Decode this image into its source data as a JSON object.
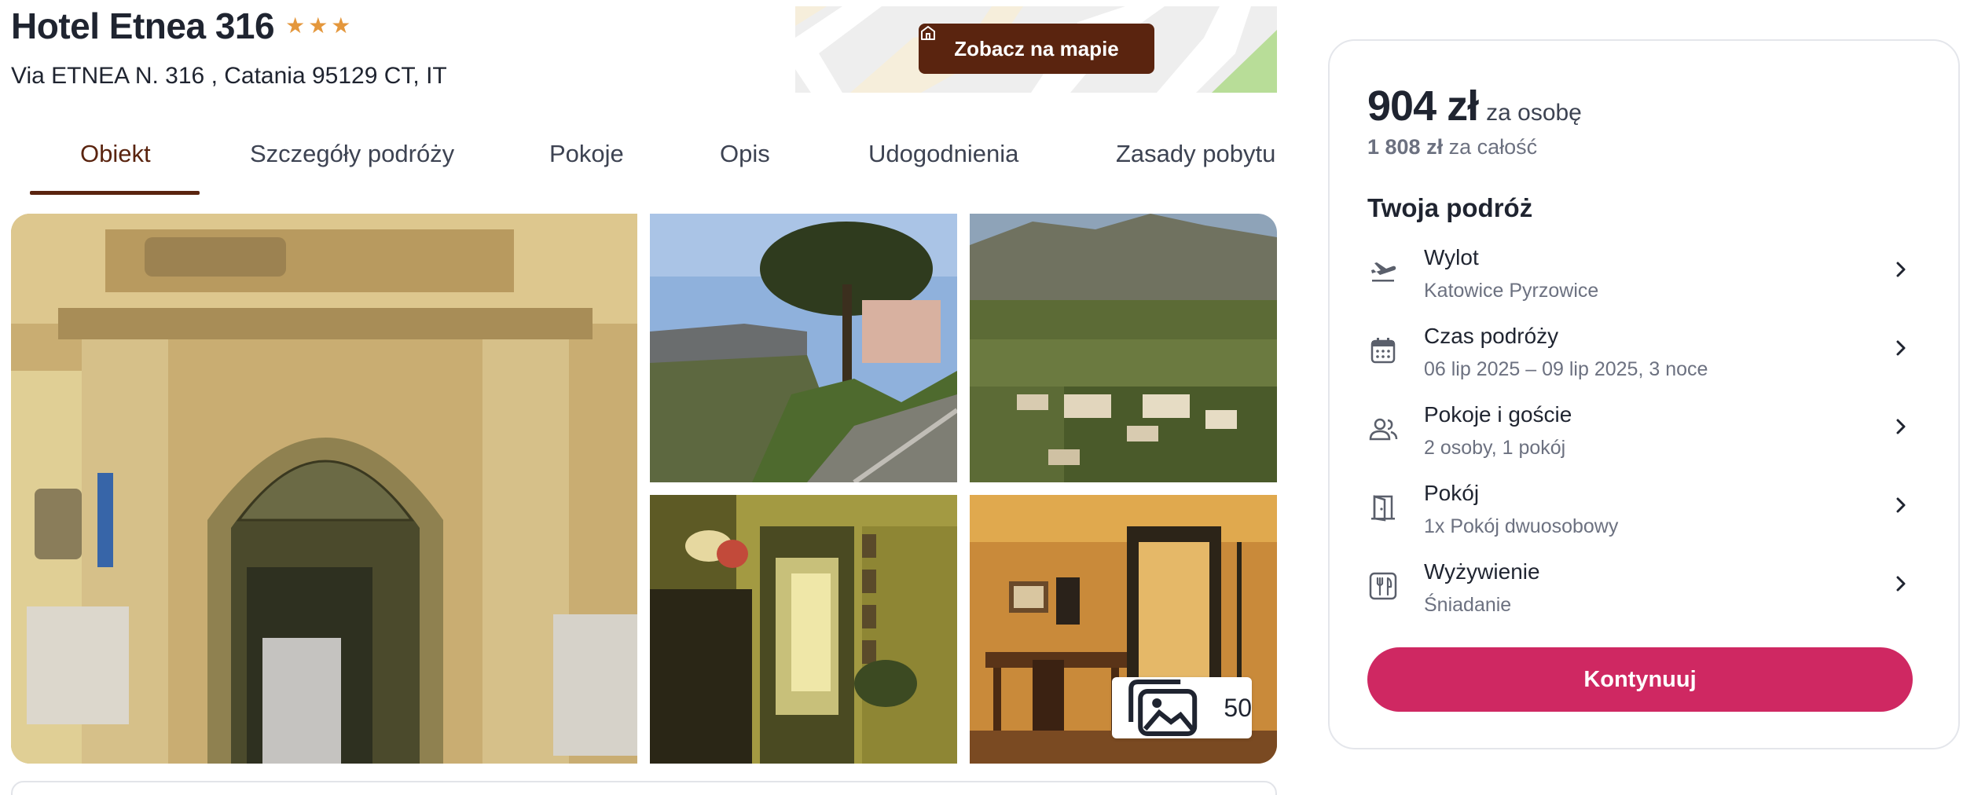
{
  "hotel": {
    "name": "Hotel Etnea 316",
    "stars": 3,
    "address": "Via ETNEA N. 316 , Catania 95129 CT, IT"
  },
  "map": {
    "button_label": "Zobacz na mapie",
    "icon": "house-icon"
  },
  "tabs": [
    {
      "label": "Obiekt",
      "active": true
    },
    {
      "label": "Szczegóły podróży",
      "active": false
    },
    {
      "label": "Pokoje",
      "active": false
    },
    {
      "label": "Opis",
      "active": false
    },
    {
      "label": "Udogodnienia",
      "active": false
    },
    {
      "label": "Zasady pobytu",
      "active": false
    }
  ],
  "gallery": {
    "photo_count": "50",
    "count_icon": "photos-icon"
  },
  "booking": {
    "price_per_person": "904 zł",
    "per_person_label": "za osobę",
    "total_price": "1 808 zł",
    "total_label": "za całość",
    "trip_title": "Twoja podróż",
    "rows": [
      {
        "title": "Wylot",
        "value": "Katowice Pyrzowice",
        "icon": "plane-departure-icon"
      },
      {
        "title": "Czas podróży",
        "value": "06 lip 2025 – 09 lip 2025, 3 noce",
        "icon": "calendar-icon"
      },
      {
        "title": "Pokoje i goście",
        "value": "2 osoby, 1 pokój",
        "icon": "guests-icon"
      },
      {
        "title": "Pokój",
        "value": "1x Pokój dwuosobowy",
        "icon": "door-icon"
      },
      {
        "title": "Wyżywienie",
        "value": "Śniadanie",
        "icon": "cutlery-icon"
      }
    ],
    "continue_label": "Kontynuuj"
  },
  "colors": {
    "brand_brown": "#5a240f",
    "accent_pink": "#cf2862",
    "star": "#e4973c"
  }
}
